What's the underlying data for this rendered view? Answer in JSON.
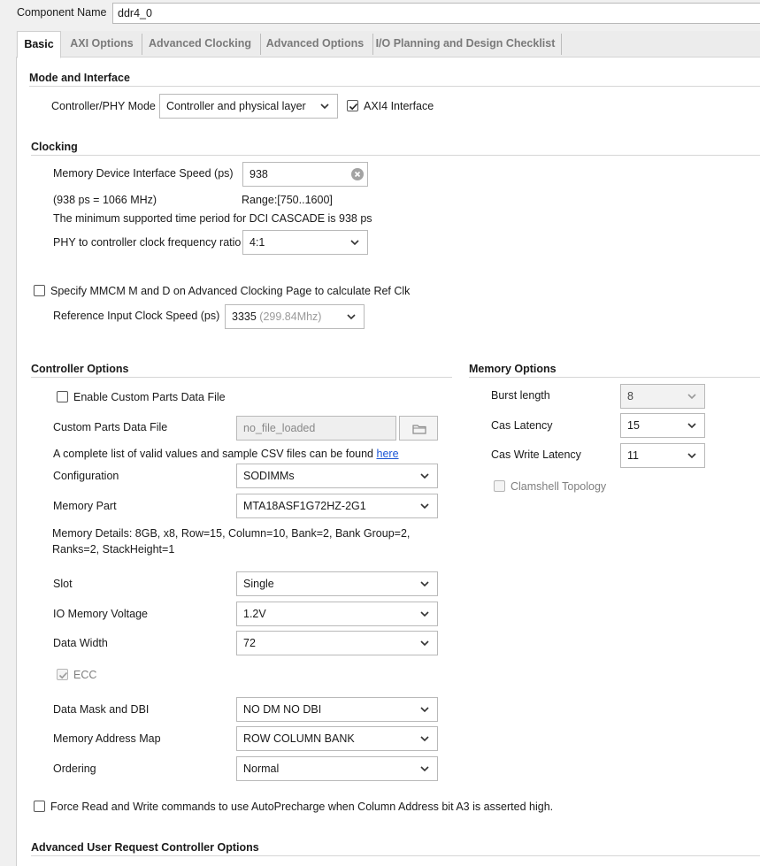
{
  "component": {
    "label": "Component Name",
    "value": "ddr4_0"
  },
  "tabs": [
    {
      "label": "Basic",
      "active": true
    },
    {
      "label": "AXI Options",
      "active": false
    },
    {
      "label": "Advanced Clocking",
      "active": false
    },
    {
      "label": "Advanced Options",
      "active": false
    },
    {
      "label": "I/O Planning and Design Checklist",
      "active": false
    }
  ],
  "mode": {
    "title": "Mode and Interface",
    "phy_mode_label": "Controller/PHY Mode",
    "phy_mode_value": "Controller and physical layer",
    "axi4_label": "AXI4 Interface",
    "axi4_checked": true
  },
  "clocking": {
    "title": "Clocking",
    "speed_label": "Memory Device Interface Speed (ps)",
    "speed_value": "938",
    "speed_note": "(938 ps = 1066 MHz)",
    "range_text": "Range:[750..1600]",
    "dci_note": "The minimum supported time period for DCI CASCADE is 938 ps",
    "ratio_label": "PHY to controller clock frequency ratio",
    "ratio_value": "4:1",
    "mmcm_label": "Specify MMCM M and D on Advanced Clocking Page to calculate Ref Clk",
    "mmcm_checked": false,
    "ref_label": "Reference Input Clock Speed (ps)",
    "ref_value": "3335",
    "ref_hint": "(299.84Mhz)"
  },
  "controller": {
    "title": "Controller Options",
    "custom_parts_label": "Enable Custom Parts Data File",
    "custom_parts_checked": false,
    "custom_file_label": "Custom Parts Data File",
    "custom_file_value": "no_file_loaded",
    "csv_note": "A complete list of valid values and sample CSV files can be found",
    "csv_link": "here",
    "configuration_label": "Configuration",
    "configuration_value": "SODIMMs",
    "memory_part_label": "Memory Part",
    "memory_part_value": "MTA18ASF1G72HZ-2G1",
    "details_line1": "Memory Details: 8GB, x8, Row=15, Column=10, Bank=2, Bank Group=2,",
    "details_line2": "Ranks=2, StackHeight=1",
    "slot_label": "Slot",
    "slot_value": "Single",
    "voltage_label": "IO Memory Voltage",
    "voltage_value": "1.2V",
    "width_label": "Data Width",
    "width_value": "72",
    "ecc_label": "ECC",
    "ecc_checked": true,
    "dm_label": "Data Mask and DBI",
    "dm_value": "NO DM NO DBI",
    "addrmap_label": "Memory Address Map",
    "addrmap_value": "ROW COLUMN BANK",
    "ordering_label": "Ordering",
    "ordering_value": "Normal"
  },
  "memory": {
    "title": "Memory Options",
    "burst_label": "Burst length",
    "burst_value": "8",
    "cas_label": "Cas Latency",
    "cas_value": "15",
    "cwl_label": "Cas Write Latency",
    "cwl_value": "11",
    "clamshell_label": "Clamshell Topology",
    "clamshell_checked": false
  },
  "autoprecharge": {
    "label": "Force Read and Write commands to use AutoPrecharge when Column Address bit A3 is asserted high.",
    "checked": false
  },
  "advanced_user": {
    "title": "Advanced User Request Controller Options"
  }
}
